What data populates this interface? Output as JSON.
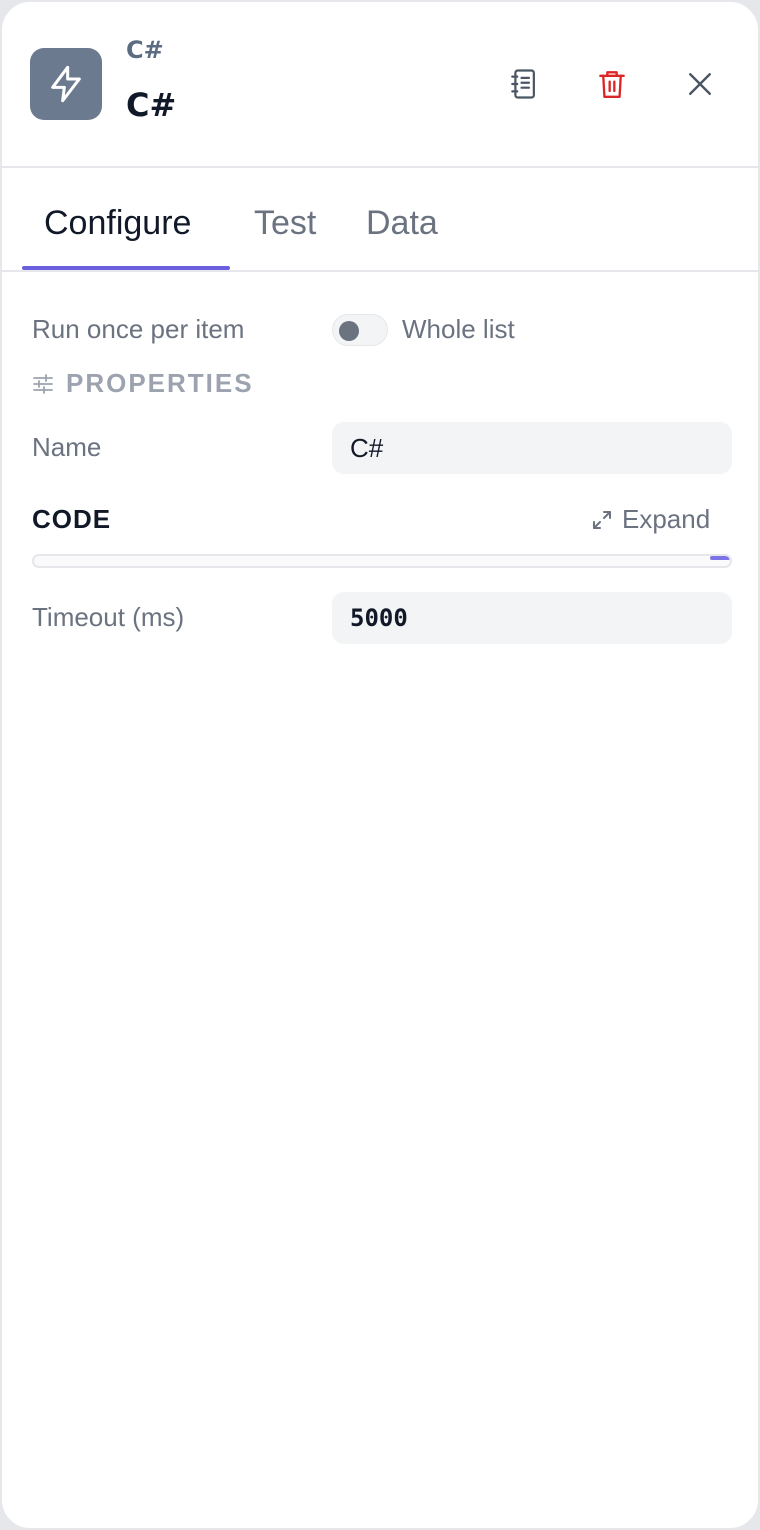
{
  "header": {
    "node_type": "C#",
    "node_title": "C#",
    "icon": "lightning-bolt-icon",
    "icon_bg_color": "#6b7a8f",
    "actions": {
      "docs_icon": "notebook-icon",
      "delete_icon": "trash-icon",
      "delete_color": "#dc2626",
      "close_icon": "close-icon"
    }
  },
  "tabs": [
    {
      "label": "Configure",
      "active": true
    },
    {
      "label": "Test",
      "active": false
    },
    {
      "label": "Data",
      "active": false
    }
  ],
  "accent_color": "#6b5fe0",
  "mode": {
    "label": "Run once per item",
    "toggle_on": false,
    "alt_label": "Whole list"
  },
  "properties": {
    "section_title": "PROPERTIES",
    "icon": "sliders-icon",
    "name_label": "Name",
    "name_value": "C#"
  },
  "code": {
    "label": "CODE",
    "expand_label": "Expand",
    "expand_icon": "expand-arrows-icon"
  },
  "timeout": {
    "label": "Timeout (ms)",
    "value": "5000"
  }
}
